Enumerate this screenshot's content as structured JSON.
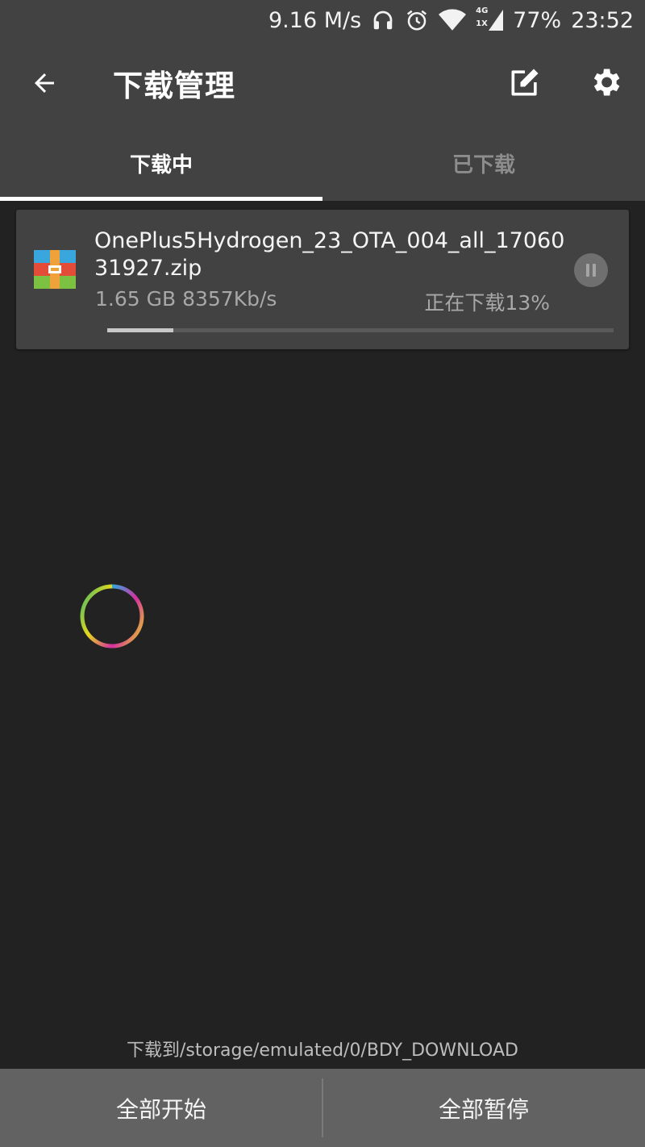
{
  "status_bar": {
    "net_speed": "9.16 M/s",
    "network_type": "4G",
    "network_sub": "1X",
    "battery": "77%",
    "time": "23:52",
    "icons": [
      "headset-icon",
      "alarm-icon",
      "wifi-icon",
      "cell-signal-icon"
    ]
  },
  "app_bar": {
    "title": "下载管理",
    "back_icon": "arrow-back-icon",
    "edit_icon": "edit-icon",
    "settings_icon": "gear-icon"
  },
  "tabs": [
    {
      "label": "下载中",
      "active": true
    },
    {
      "label": "已下载",
      "active": false
    }
  ],
  "download": {
    "file_name": "OnePlus5Hydrogen_23_OTA_004_all_1706031927.zip",
    "meta": "1.65 GB 8357Kb/s",
    "status": "正在下载13%",
    "progress": 0.13,
    "icon": "archive-file-icon",
    "action_icon": "pause-icon"
  },
  "footer": {
    "save_path": "下载到/storage/emulated/0/BDY_DOWNLOAD",
    "start_all": "全部开始",
    "pause_all": "全部暂停"
  },
  "colors": {
    "background": "#222222",
    "bar": "#424242",
    "bottom_bar": "#626262",
    "accent": "#ffffff"
  }
}
